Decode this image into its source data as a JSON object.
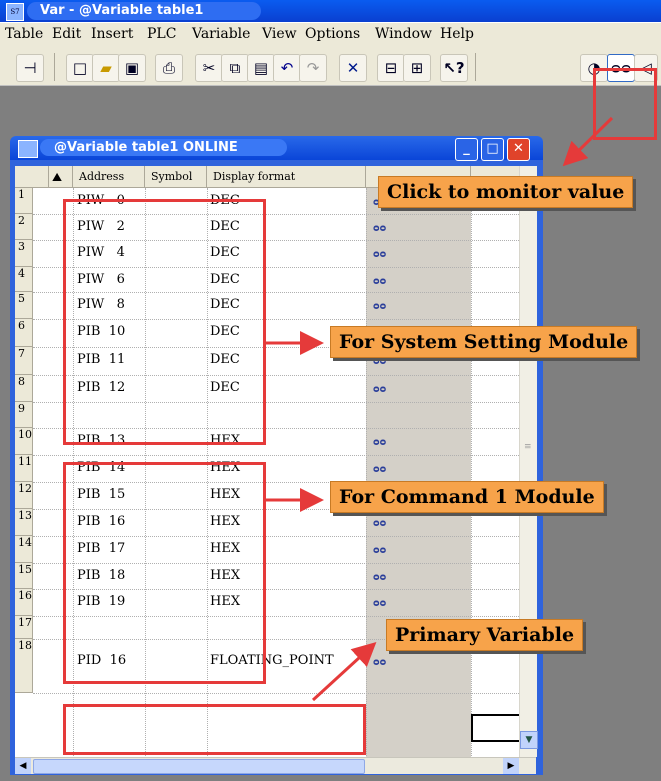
{
  "window": {
    "title": "Var - @Variable table1"
  },
  "menu": [
    "Table",
    "Edit",
    "Insert",
    "PLC",
    "Variable",
    "View",
    "Options",
    "Window",
    "Help"
  ],
  "toolbar_icons": [
    "pin-icon",
    "new-icon",
    "open-icon",
    "save-icon",
    "print-icon",
    "cut-icon",
    "copy-icon",
    "paste-icon",
    "undo-icon",
    "redo-icon",
    "delete-icon",
    "network-icon",
    "accessible-icon",
    "help-pointer-icon",
    "monitor-glasses-icon",
    "monitor-value-icon",
    "more-icon"
  ],
  "inner_window": {
    "title": "@Variable table1  ONLINE"
  },
  "table": {
    "headers": [
      "Address",
      "Symbol",
      "Display format"
    ],
    "rows": [
      {
        "num": "1",
        "address": "PIW   0",
        "format": "DEC"
      },
      {
        "num": "2",
        "address": "PIW   2",
        "format": "DEC"
      },
      {
        "num": "3",
        "address": "PIW   4",
        "format": "DEC"
      },
      {
        "num": "4",
        "address": "PIW   6",
        "format": "DEC"
      },
      {
        "num": "5",
        "address": "PIW   8",
        "format": "DEC"
      },
      {
        "num": "6",
        "address": "PIB  10",
        "format": "DEC"
      },
      {
        "num": "7",
        "address": "PIB  11",
        "format": "DEC"
      },
      {
        "num": "8",
        "address": "PIB  12",
        "format": "DEC"
      },
      {
        "num": "9",
        "address": "",
        "format": ""
      },
      {
        "num": "10",
        "address": "PIB  13",
        "format": "HEX"
      },
      {
        "num": "11",
        "address": "PIB  14",
        "format": "HEX"
      },
      {
        "num": "12",
        "address": "PIB  15",
        "format": "HEX"
      },
      {
        "num": "13",
        "address": "PIB  16",
        "format": "HEX"
      },
      {
        "num": "14",
        "address": "PIB  17",
        "format": "HEX"
      },
      {
        "num": "15",
        "address": "PIB  18",
        "format": "HEX"
      },
      {
        "num": "16",
        "address": "PIB  19",
        "format": "HEX"
      },
      {
        "num": "17",
        "address": "",
        "format": ""
      },
      {
        "num": "18",
        "address": "PID  16",
        "format": "FLOATING_POINT"
      }
    ]
  },
  "annotations": {
    "monitor": "Click to monitor value",
    "system": "For System Setting Module",
    "command": "For Command 1 Module",
    "primary": "Primary Variable",
    "color": "#e53a3a",
    "callout_color": "#f7a34a"
  }
}
